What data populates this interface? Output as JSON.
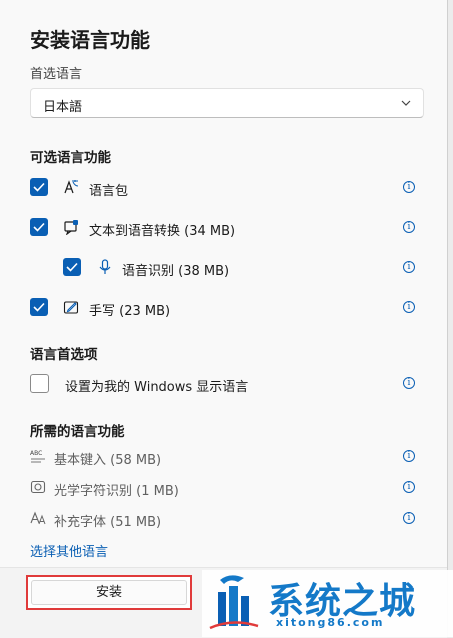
{
  "dialog": {
    "title": "安装语言功能",
    "preferred_language_label": "首选语言",
    "preferred_language_value": "日本語"
  },
  "optional_features": {
    "heading": "可选语言功能",
    "items": [
      {
        "label": "语言包",
        "checked": true,
        "icon": "language-pack-icon"
      },
      {
        "label": "文本到语音转换 (34 MB)",
        "checked": true,
        "icon": "text-to-speech-icon"
      },
      {
        "label": "语音识别 (38 MB)",
        "checked": true,
        "icon": "microphone-icon"
      },
      {
        "label": "手写 (23 MB)",
        "checked": true,
        "icon": "handwriting-icon"
      }
    ]
  },
  "language_preferences": {
    "heading": "语言首选项",
    "display_language_label": "设置为我的 Windows 显示语言",
    "display_language_checked": false
  },
  "required_features": {
    "heading": "所需的语言功能",
    "items": [
      {
        "label": "基本键入 (58 MB)",
        "icon": "basic-typing-icon"
      },
      {
        "label": "光学字符识别 (1 MB)",
        "icon": "ocr-icon"
      },
      {
        "label": "补充字体 (51 MB)",
        "icon": "fonts-icon"
      }
    ]
  },
  "link": {
    "choose_other_language": "选择其他语言"
  },
  "footer": {
    "install_label": "安装"
  },
  "watermark": {
    "brand": "系统之城",
    "url": "xitong86.com"
  },
  "colors": {
    "accent": "#0a5fb4",
    "highlight": "#e03a3a",
    "watermark": "#1479c8"
  }
}
